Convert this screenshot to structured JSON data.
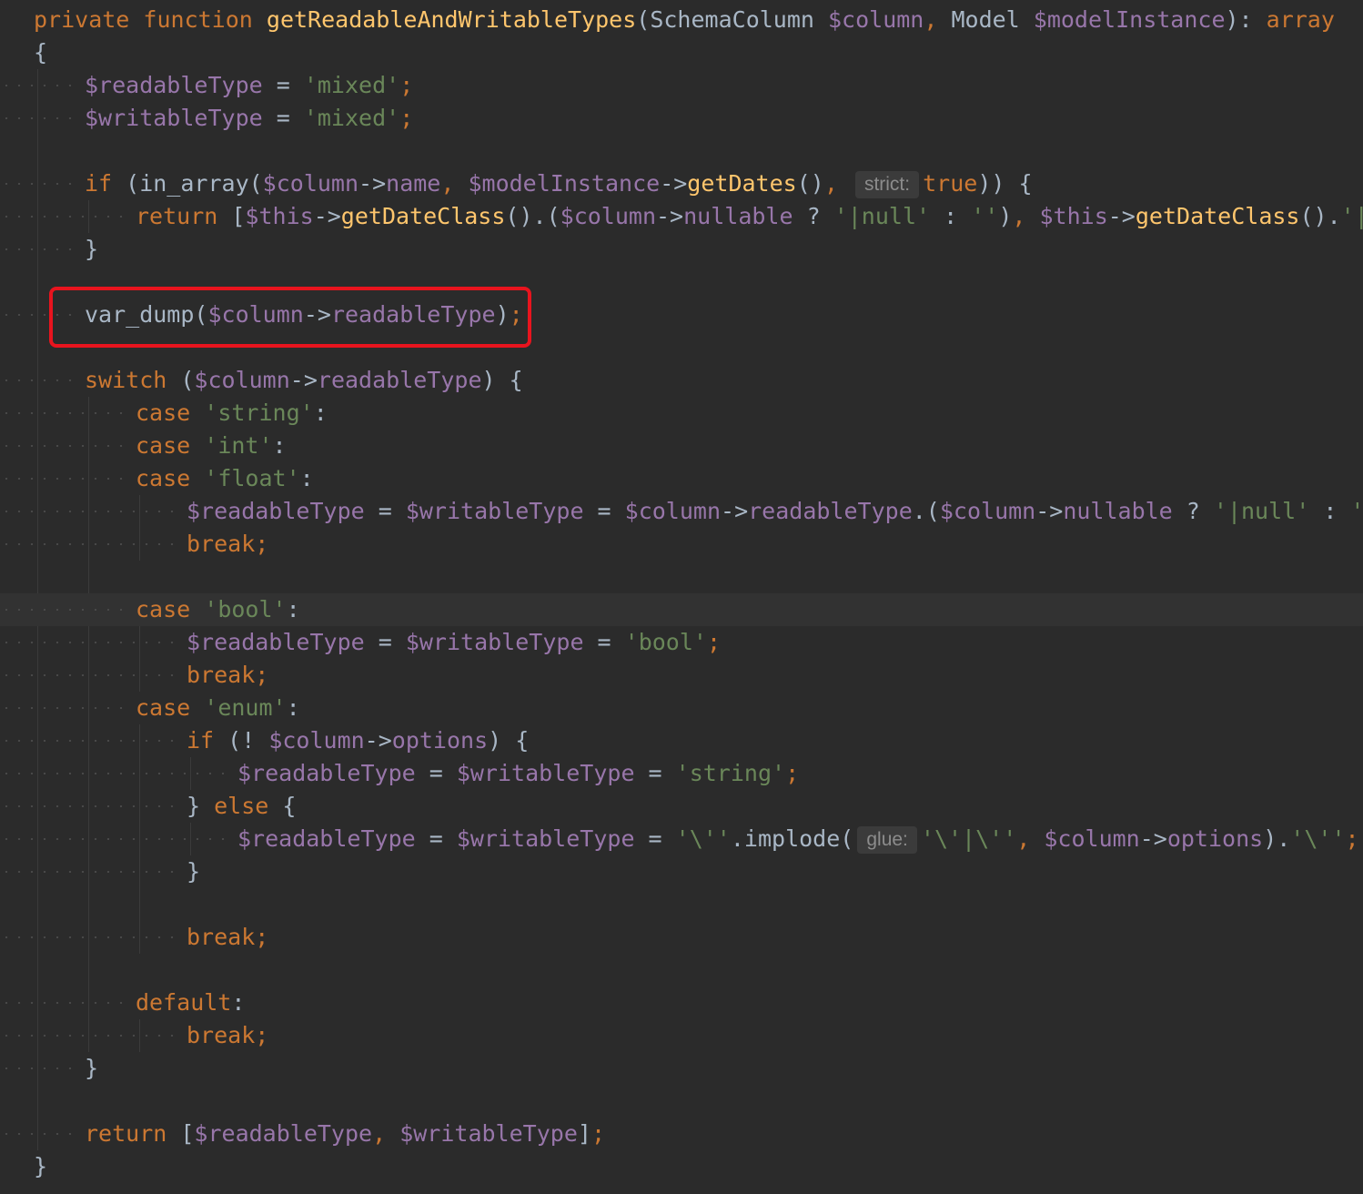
{
  "editor": {
    "language": "PHP",
    "theme": "darcula",
    "colors": {
      "background": "#2b2b2b",
      "keyword": "#cc7832",
      "function": "#ffc66d",
      "variable": "#9876aa",
      "string": "#6a8759",
      "plain": "#a9b7c6",
      "annotation_box": "#e8141e"
    },
    "highlighted_line": "var_dump($column->readableType);",
    "lines": [
      {
        "indent": 0,
        "tokens": [
          [
            "kw",
            "private "
          ],
          [
            "kw",
            "function "
          ],
          [
            "fn",
            "getReadableAndWritableTypes"
          ],
          [
            "plain",
            "(SchemaColumn "
          ],
          [
            "var",
            "$column"
          ],
          [
            "kw",
            ", "
          ],
          [
            "plain",
            "Model "
          ],
          [
            "var",
            "$modelInstance"
          ],
          [
            "plain",
            "): "
          ],
          [
            "kw",
            "array"
          ]
        ]
      },
      {
        "indent": 0,
        "tokens": [
          [
            "plain",
            "{"
          ]
        ]
      },
      {
        "indent": 1,
        "tokens": [
          [
            "var",
            "$readableType"
          ],
          [
            "plain",
            " = "
          ],
          [
            "str",
            "'mixed'"
          ],
          [
            "kw",
            ";"
          ]
        ]
      },
      {
        "indent": 1,
        "tokens": [
          [
            "var",
            "$writableType"
          ],
          [
            "plain",
            " = "
          ],
          [
            "str",
            "'mixed'"
          ],
          [
            "kw",
            ";"
          ]
        ]
      },
      {
        "indent": 0,
        "tokens": []
      },
      {
        "indent": 1,
        "tokens": [
          [
            "kw",
            "if "
          ],
          [
            "plain",
            "(in_array("
          ],
          [
            "var",
            "$column"
          ],
          [
            "plain",
            "->"
          ],
          [
            "var",
            "name"
          ],
          [
            "kw",
            ", "
          ],
          [
            "var",
            "$modelInstance"
          ],
          [
            "plain",
            "->"
          ],
          [
            "fn",
            "getDates"
          ],
          [
            "plain",
            "()"
          ],
          [
            "kw",
            ", "
          ],
          [
            "hint",
            "strict:"
          ],
          [
            "kw",
            "true"
          ],
          [
            "plain",
            ")) {"
          ]
        ]
      },
      {
        "indent": 2,
        "tokens": [
          [
            "kw",
            "return "
          ],
          [
            "plain",
            "["
          ],
          [
            "var",
            "$this"
          ],
          [
            "plain",
            "->"
          ],
          [
            "fn",
            "getDateClass"
          ],
          [
            "plain",
            "().("
          ],
          [
            "var",
            "$column"
          ],
          [
            "plain",
            "->"
          ],
          [
            "var",
            "nullable"
          ],
          [
            "plain",
            " ? "
          ],
          [
            "str",
            "'|null'"
          ],
          [
            "plain",
            " : "
          ],
          [
            "str",
            "''"
          ],
          [
            "plain",
            ")"
          ],
          [
            "kw",
            ", "
          ],
          [
            "var",
            "$this"
          ],
          [
            "plain",
            "->"
          ],
          [
            "fn",
            "getDateClass"
          ],
          [
            "plain",
            "()."
          ],
          [
            "str",
            "'|string"
          ]
        ]
      },
      {
        "indent": 1,
        "tokens": [
          [
            "plain",
            "}"
          ]
        ]
      },
      {
        "indent": 0,
        "tokens": []
      },
      {
        "indent": 1,
        "tokens": [
          [
            "plain",
            "var_dump("
          ],
          [
            "var",
            "$column"
          ],
          [
            "plain",
            "->"
          ],
          [
            "var",
            "readableType"
          ],
          [
            "plain",
            ")"
          ],
          [
            "kw",
            ";"
          ]
        ]
      },
      {
        "indent": 0,
        "tokens": []
      },
      {
        "indent": 1,
        "tokens": [
          [
            "kw",
            "switch "
          ],
          [
            "plain",
            "("
          ],
          [
            "var",
            "$column"
          ],
          [
            "plain",
            "->"
          ],
          [
            "var",
            "readableType"
          ],
          [
            "plain",
            ") {"
          ]
        ]
      },
      {
        "indent": 2,
        "tokens": [
          [
            "kw",
            "case "
          ],
          [
            "str",
            "'string'"
          ],
          [
            "plain",
            ":"
          ]
        ]
      },
      {
        "indent": 2,
        "tokens": [
          [
            "kw",
            "case "
          ],
          [
            "str",
            "'int'"
          ],
          [
            "plain",
            ":"
          ]
        ]
      },
      {
        "indent": 2,
        "tokens": [
          [
            "kw",
            "case "
          ],
          [
            "str",
            "'float'"
          ],
          [
            "plain",
            ":"
          ]
        ]
      },
      {
        "indent": 3,
        "tokens": [
          [
            "var",
            "$readableType"
          ],
          [
            "plain",
            " = "
          ],
          [
            "var",
            "$writableType"
          ],
          [
            "plain",
            " = "
          ],
          [
            "var",
            "$column"
          ],
          [
            "plain",
            "->"
          ],
          [
            "var",
            "readableType"
          ],
          [
            "plain",
            ".("
          ],
          [
            "var",
            "$column"
          ],
          [
            "plain",
            "->"
          ],
          [
            "var",
            "nullable"
          ],
          [
            "plain",
            " ? "
          ],
          [
            "str",
            "'|null'"
          ],
          [
            "plain",
            " : "
          ],
          [
            "str",
            "''"
          ],
          [
            "plain",
            ")"
          ],
          [
            "kw",
            ";"
          ]
        ]
      },
      {
        "indent": 3,
        "tokens": [
          [
            "kw",
            "break;"
          ]
        ]
      },
      {
        "indent": 0,
        "tokens": []
      },
      {
        "indent": 2,
        "tokens": [
          [
            "kw",
            "case "
          ],
          [
            "str",
            "'bool'"
          ],
          [
            "plain",
            ":"
          ]
        ]
      },
      {
        "indent": 3,
        "tokens": [
          [
            "var",
            "$readableType"
          ],
          [
            "plain",
            " = "
          ],
          [
            "var",
            "$writableType"
          ],
          [
            "plain",
            " = "
          ],
          [
            "str",
            "'bool'"
          ],
          [
            "kw",
            ";"
          ]
        ]
      },
      {
        "indent": 3,
        "tokens": [
          [
            "kw",
            "break;"
          ]
        ]
      },
      {
        "indent": 2,
        "tokens": [
          [
            "kw",
            "case "
          ],
          [
            "str",
            "'enum'"
          ],
          [
            "plain",
            ":"
          ]
        ]
      },
      {
        "indent": 3,
        "tokens": [
          [
            "kw",
            "if "
          ],
          [
            "plain",
            "(! "
          ],
          [
            "var",
            "$column"
          ],
          [
            "plain",
            "->"
          ],
          [
            "var",
            "options"
          ],
          [
            "plain",
            ") {"
          ]
        ]
      },
      {
        "indent": 4,
        "tokens": [
          [
            "var",
            "$readableType"
          ],
          [
            "plain",
            " = "
          ],
          [
            "var",
            "$writableType"
          ],
          [
            "plain",
            " = "
          ],
          [
            "str",
            "'string'"
          ],
          [
            "kw",
            ";"
          ]
        ]
      },
      {
        "indent": 3,
        "tokens": [
          [
            "plain",
            "} "
          ],
          [
            "kw",
            "else "
          ],
          [
            "plain",
            "{"
          ]
        ]
      },
      {
        "indent": 4,
        "tokens": [
          [
            "var",
            "$readableType"
          ],
          [
            "plain",
            " = "
          ],
          [
            "var",
            "$writableType"
          ],
          [
            "plain",
            " = "
          ],
          [
            "str",
            "'\\''"
          ],
          [
            "plain",
            ".implode("
          ],
          [
            "hint",
            "glue:"
          ],
          [
            "str",
            "'\\'|\\''"
          ],
          [
            "kw",
            ", "
          ],
          [
            "var",
            "$column"
          ],
          [
            "plain",
            "->"
          ],
          [
            "var",
            "options"
          ],
          [
            "plain",
            ")."
          ],
          [
            "str",
            "'\\''"
          ],
          [
            "kw",
            ";"
          ]
        ]
      },
      {
        "indent": 3,
        "tokens": [
          [
            "plain",
            "}"
          ]
        ]
      },
      {
        "indent": 0,
        "tokens": []
      },
      {
        "indent": 3,
        "tokens": [
          [
            "kw",
            "break;"
          ]
        ]
      },
      {
        "indent": 0,
        "tokens": []
      },
      {
        "indent": 2,
        "tokens": [
          [
            "kw",
            "default"
          ],
          [
            "plain",
            ":"
          ]
        ]
      },
      {
        "indent": 3,
        "tokens": [
          [
            "kw",
            "break;"
          ]
        ]
      },
      {
        "indent": 1,
        "tokens": [
          [
            "plain",
            "}"
          ]
        ]
      },
      {
        "indent": 0,
        "tokens": []
      },
      {
        "indent": 1,
        "tokens": [
          [
            "kw",
            "return "
          ],
          [
            "plain",
            "["
          ],
          [
            "var",
            "$readableType"
          ],
          [
            "kw",
            ", "
          ],
          [
            "var",
            "$writableType"
          ],
          [
            "plain",
            "]"
          ],
          [
            "kw",
            ";"
          ]
        ]
      },
      {
        "indent": 0,
        "tokens": [
          [
            "plain",
            "}"
          ]
        ]
      }
    ]
  }
}
